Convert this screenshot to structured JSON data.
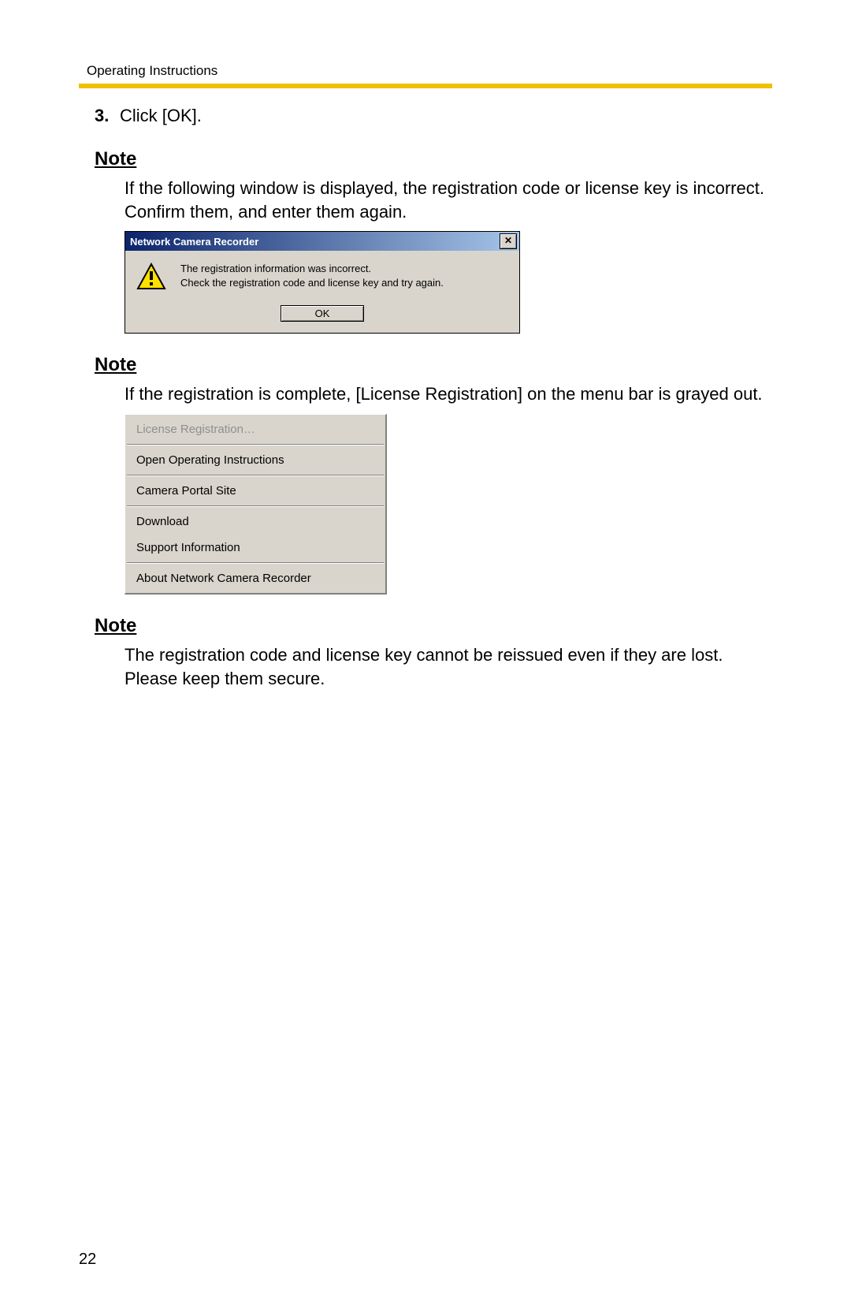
{
  "header": {
    "running": "Operating Instructions"
  },
  "step": {
    "number": "3.",
    "text": "Click [OK]."
  },
  "notes": {
    "n1": {
      "label": "Note",
      "text": "If the following window is displayed, the registration code or license key is incorrect. Confirm them, and enter them again."
    },
    "n2": {
      "label": "Note",
      "text": "If the registration is complete, [License Registration] on the menu bar is grayed out."
    },
    "n3": {
      "label": "Note",
      "text": "The registration code and license key cannot be reissued even if they are lost. Please keep them secure."
    }
  },
  "dialog": {
    "title": "Network Camera Recorder",
    "message_line1": "The registration information was incorrect.",
    "message_line2": "Check the registration code and license key and try again.",
    "ok_label": "OK",
    "close_glyph": "✕"
  },
  "menu": {
    "items": [
      {
        "label": "License Registration…",
        "grayed": true
      },
      {
        "label": "Open Operating Instructions",
        "grayed": false
      },
      {
        "label": "Camera Portal Site",
        "grayed": false
      },
      {
        "label": "Download",
        "grayed": false
      },
      {
        "label": "Support Information",
        "grayed": false
      },
      {
        "label": "About Network Camera Recorder",
        "grayed": false
      }
    ]
  },
  "page_number": "22"
}
